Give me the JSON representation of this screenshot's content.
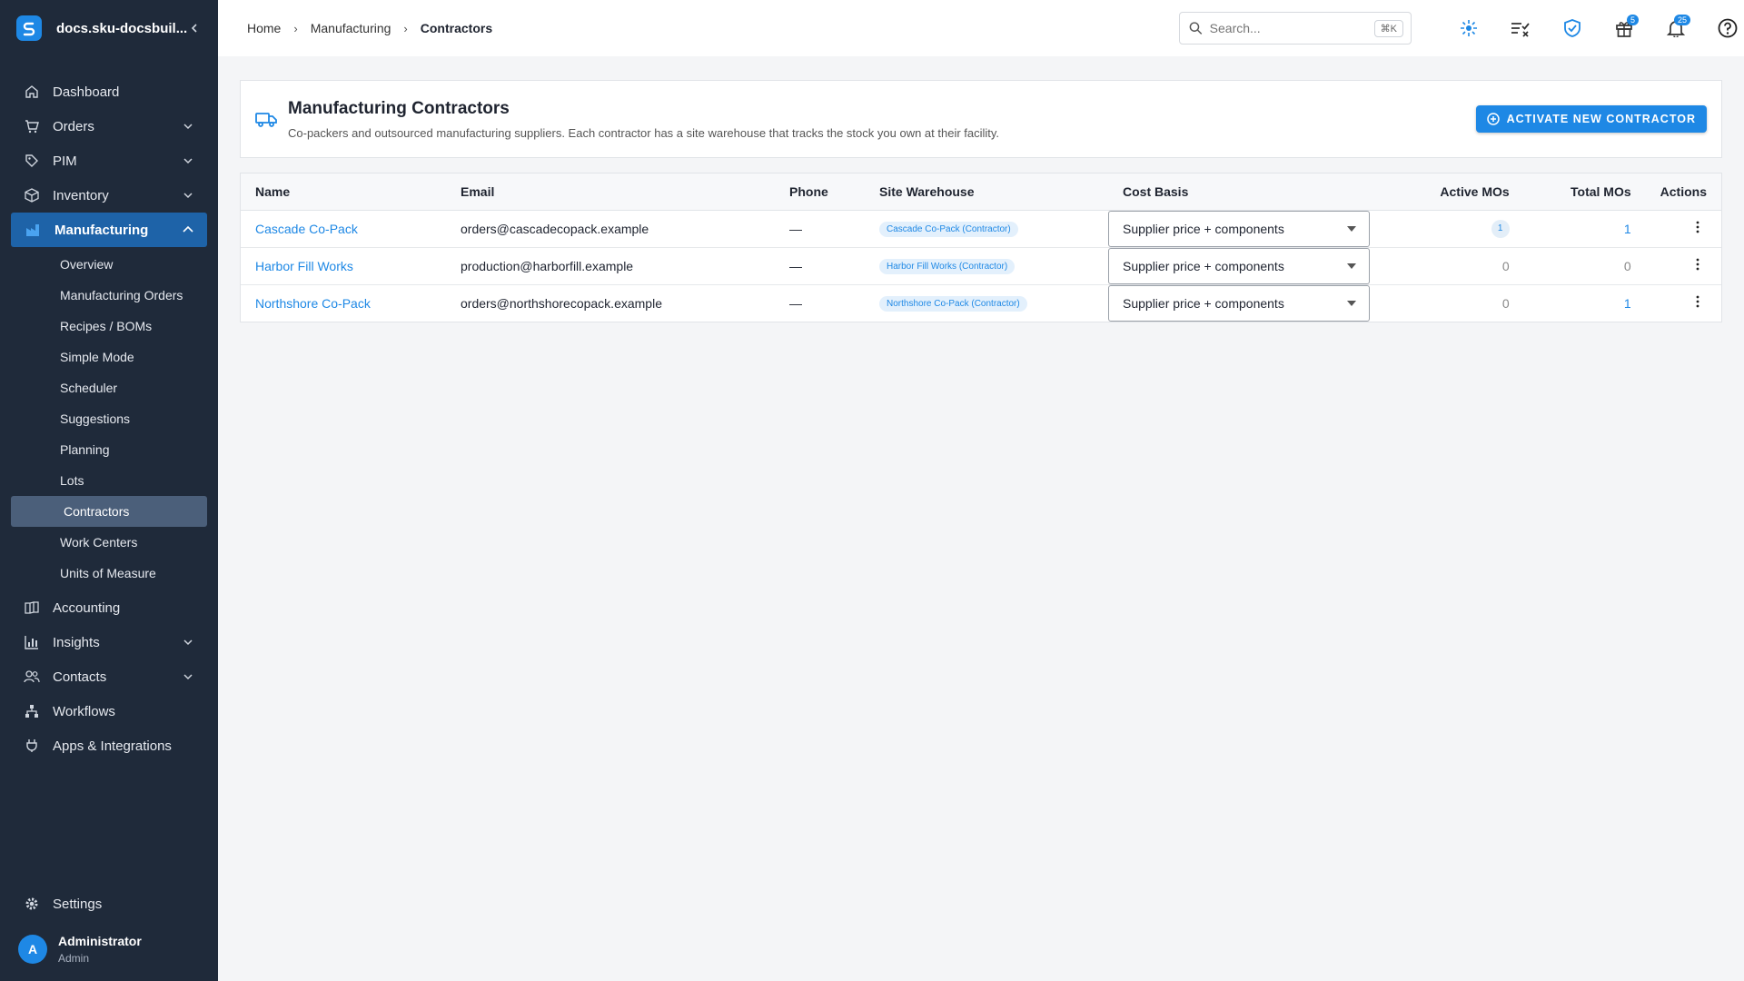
{
  "app": {
    "workspace": "docs.sku-docsbuil...",
    "colors": {
      "sidebar_bg": "#1f2a3a",
      "accent": "#1e88e5",
      "active_nav": "#1e63a8",
      "active_sub": "#4b5f7a"
    }
  },
  "sidebar": {
    "items": [
      {
        "label": "Dashboard",
        "icon": "home-icon"
      },
      {
        "label": "Orders",
        "icon": "cart-icon"
      },
      {
        "label": "PIM",
        "icon": "tag-icon"
      },
      {
        "label": "Inventory",
        "icon": "box-icon"
      },
      {
        "label": "Manufacturing",
        "icon": "factory-icon"
      },
      {
        "label": "Accounting",
        "icon": "ledger-icon"
      },
      {
        "label": "Insights",
        "icon": "bar-chart-icon"
      },
      {
        "label": "Contacts",
        "icon": "people-icon"
      },
      {
        "label": "Workflows",
        "icon": "hierarchy-icon"
      },
      {
        "label": "Apps & Integrations",
        "icon": "plug-icon"
      }
    ],
    "manufacturing_sub": [
      "Overview",
      "Manufacturing Orders",
      "Recipes / BOMs",
      "Simple Mode",
      "Scheduler",
      "Suggestions",
      "Planning",
      "Lots",
      "Contractors",
      "Work Centers",
      "Units of Measure"
    ],
    "settings_label": "Settings",
    "user": {
      "initial": "A",
      "name": "Administrator",
      "role": "Admin"
    }
  },
  "topbar": {
    "breadcrumbs": [
      "Home",
      "Manufacturing",
      "Contractors"
    ],
    "search_placeholder": "Search...",
    "search_shortcut": "⌘K",
    "gift_badge": "5",
    "bell_badge": "25"
  },
  "page": {
    "title": "Manufacturing Contractors",
    "subtitle": "Co-packers and outsourced manufacturing suppliers. Each contractor has a site warehouse that tracks the stock you own at their facility.",
    "activate_button": "ACTIVATE NEW CONTRACTOR"
  },
  "table": {
    "columns": [
      "Name",
      "Email",
      "Phone",
      "Site Warehouse",
      "Cost Basis",
      "Active MOs",
      "Total MOs",
      "Actions"
    ],
    "rows": [
      {
        "name": "Cascade Co-Pack",
        "email": "orders@cascadecopack.example",
        "phone": "—",
        "warehouse": "Cascade Co-Pack (Contractor)",
        "cost_basis": "Supplier price + components",
        "active_mos": "1",
        "total_mos": "1"
      },
      {
        "name": "Harbor Fill Works",
        "email": "production@harborfill.example",
        "phone": "—",
        "warehouse": "Harbor Fill Works (Contractor)",
        "cost_basis": "Supplier price + components",
        "active_mos": "0",
        "total_mos": "0"
      },
      {
        "name": "Northshore Co-Pack",
        "email": "orders@northshorecopack.example",
        "phone": "—",
        "warehouse": "Northshore Co-Pack (Contractor)",
        "cost_basis": "Supplier price + components",
        "active_mos": "0",
        "total_mos": "1"
      }
    ]
  }
}
